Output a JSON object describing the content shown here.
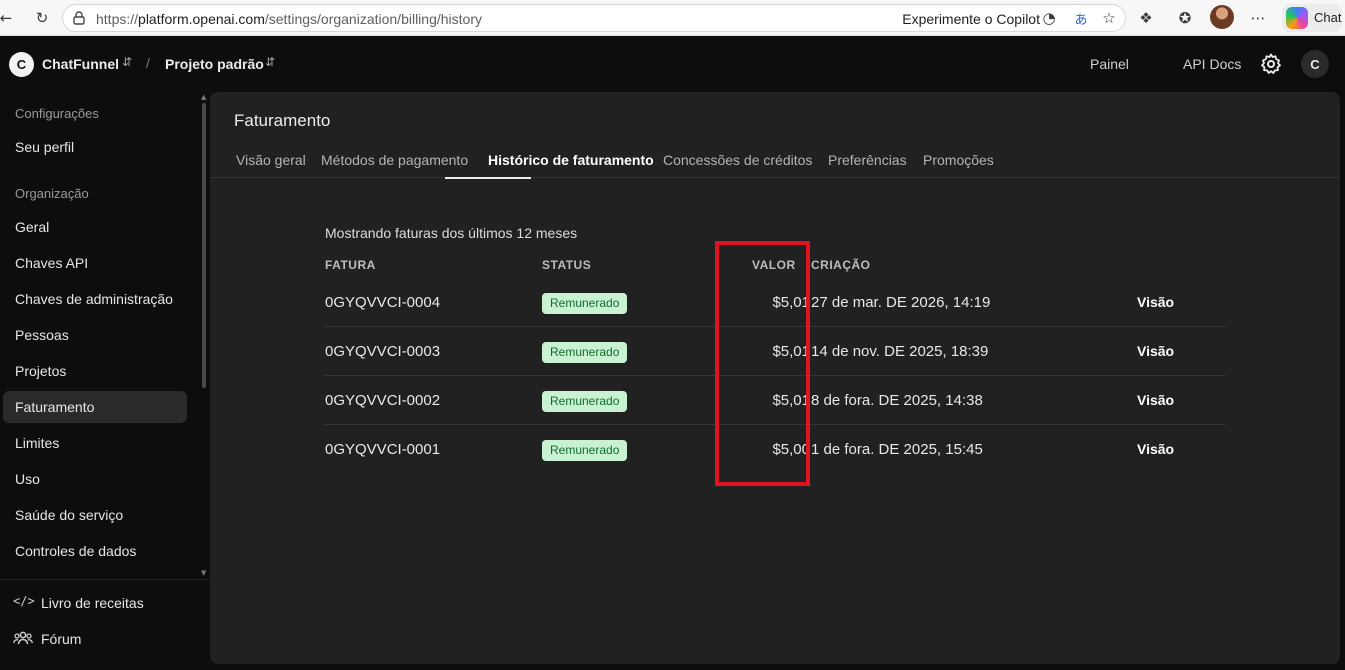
{
  "browser": {
    "url_prefix": "https://",
    "url_host": "platform.openai.com",
    "url_path": "/settings/organization/billing/history",
    "copilot_prompt": "Experimente o Copilot",
    "chat_label": "Chat"
  },
  "header": {
    "org_initial": "C",
    "org_name": "ChatFunnel",
    "separator": "/",
    "project_name": "Projeto padrão",
    "links": [
      "Painel",
      "API Docs"
    ],
    "user_initial": "C"
  },
  "sidebar": {
    "section_settings": "Configurações",
    "profile": "Seu perfil",
    "section_org": "Organização",
    "items": [
      "Geral",
      "Chaves API",
      "Chaves de administração",
      "Pessoas",
      "Projetos",
      "Faturamento",
      "Limites",
      "Uso",
      "Saúde do serviço",
      "Controles de dados"
    ],
    "active_item": "Faturamento",
    "bottom": [
      "Livro de receitas",
      "Fórum"
    ]
  },
  "main": {
    "title": "Faturamento",
    "tabs": [
      "Visão geral",
      "Métodos de pagamento",
      "Histórico de faturamento",
      "Concessões de créditos",
      "Preferências",
      "Promoções"
    ],
    "active_tab": "Histórico de faturamento",
    "note": "Mostrando faturas dos últimos 12 meses",
    "columns": {
      "invoice": "FATURA",
      "status": "STATUS",
      "amount": "VALOR",
      "created": "CRIAÇÃO"
    },
    "rows": [
      {
        "invoice": "0GYQVVCI-0004",
        "status": "Remunerado",
        "amount": "$5,01",
        "created": "27 de mar. DE 2026, 14:19",
        "action": "Visão"
      },
      {
        "invoice": "0GYQVVCI-0003",
        "status": "Remunerado",
        "amount": "$5,01",
        "created": "14 de nov. DE 2025, 18:39",
        "action": "Visão"
      },
      {
        "invoice": "0GYQVVCI-0002",
        "status": "Remunerado",
        "amount": "$5,01",
        "created": "8 de fora. DE 2025, 14:38",
        "action": "Visão"
      },
      {
        "invoice": "0GYQVVCI-0001",
        "status": "Remunerado",
        "amount": "$5,00",
        "created": "1 de fora. DE 2025, 15:45",
        "action": "Visão"
      }
    ]
  },
  "colors": {
    "app_bg": "#0d0d0d",
    "panel_bg": "#212121",
    "badge_bg": "#c8f2d2",
    "badge_text": "#136c2e",
    "highlight": "#e0141e"
  }
}
